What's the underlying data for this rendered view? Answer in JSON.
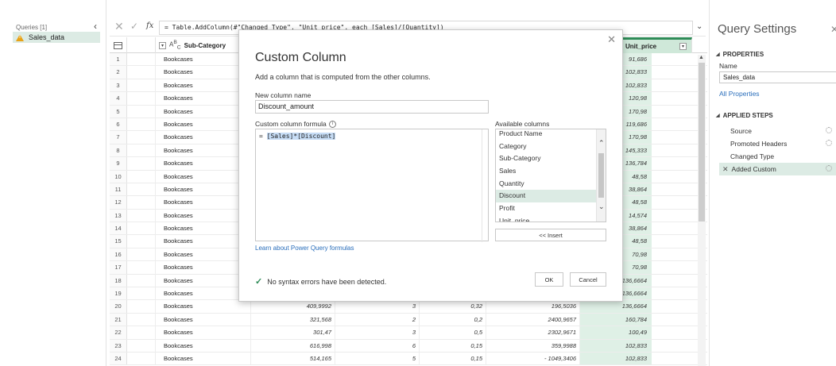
{
  "queries": {
    "title": "Queries [1]",
    "items": [
      {
        "label": "Sales_data"
      }
    ]
  },
  "formula_bar": {
    "formula": "= Table.AddColumn(#\"Changed Type\", \"Unit_price\", each [Sales]/[Quantity])"
  },
  "grid": {
    "col_sub_category": "Sub-Category",
    "col_type_icon": "ABC",
    "col_unit_price": "Unit_price",
    "rows": [
      {
        "idx": "1",
        "sub": "Bookcases",
        "sales": "",
        "qty": "",
        "disc": "",
        "profit": "",
        "unit": "91,686"
      },
      {
        "idx": "2",
        "sub": "Bookcases",
        "sales": "",
        "qty": "",
        "disc": "",
        "profit": "",
        "unit": "102,833"
      },
      {
        "idx": "3",
        "sub": "Bookcases",
        "sales": "",
        "qty": "",
        "disc": "",
        "profit": "",
        "unit": "102,833"
      },
      {
        "idx": "4",
        "sub": "Bookcases",
        "sales": "",
        "qty": "",
        "disc": "",
        "profit": "",
        "unit": "120,98"
      },
      {
        "idx": "5",
        "sub": "Bookcases",
        "sales": "",
        "qty": "",
        "disc": "",
        "profit": "",
        "unit": "170,98"
      },
      {
        "idx": "6",
        "sub": "Bookcases",
        "sales": "",
        "qty": "",
        "disc": "",
        "profit": "",
        "unit": "119,686"
      },
      {
        "idx": "7",
        "sub": "Bookcases",
        "sales": "",
        "qty": "",
        "disc": "",
        "profit": "",
        "unit": "170,98"
      },
      {
        "idx": "8",
        "sub": "Bookcases",
        "sales": "",
        "qty": "",
        "disc": "",
        "profit": "",
        "unit": "145,333"
      },
      {
        "idx": "9",
        "sub": "Bookcases",
        "sales": "",
        "qty": "",
        "disc": "",
        "profit": "",
        "unit": "136,784"
      },
      {
        "idx": "10",
        "sub": "Bookcases",
        "sales": "",
        "qty": "",
        "disc": "",
        "profit": "",
        "unit": "48,58"
      },
      {
        "idx": "11",
        "sub": "Bookcases",
        "sales": "",
        "qty": "",
        "disc": "",
        "profit": "",
        "unit": "38,864"
      },
      {
        "idx": "12",
        "sub": "Bookcases",
        "sales": "",
        "qty": "",
        "disc": "",
        "profit": "",
        "unit": "48,58"
      },
      {
        "idx": "13",
        "sub": "Bookcases",
        "sales": "",
        "qty": "",
        "disc": "",
        "profit": "",
        "unit": "14,574"
      },
      {
        "idx": "14",
        "sub": "Bookcases",
        "sales": "",
        "qty": "",
        "disc": "",
        "profit": "",
        "unit": "38,864"
      },
      {
        "idx": "15",
        "sub": "Bookcases",
        "sales": "",
        "qty": "",
        "disc": "",
        "profit": "",
        "unit": "48,58"
      },
      {
        "idx": "16",
        "sub": "Bookcases",
        "sales": "",
        "qty": "",
        "disc": "",
        "profit": "",
        "unit": "70,98"
      },
      {
        "idx": "17",
        "sub": "Bookcases",
        "sales": "",
        "qty": "",
        "disc": "",
        "profit": "",
        "unit": "70,98"
      },
      {
        "idx": "18",
        "sub": "Bookcases",
        "sales": "",
        "qty": "",
        "disc": "",
        "profit": "",
        "unit": "136,6664"
      },
      {
        "idx": "19",
        "sub": "Bookcases",
        "sales": "",
        "qty": "",
        "disc": "",
        "profit": "",
        "unit": "136,6664"
      },
      {
        "idx": "20",
        "sub": "Bookcases",
        "sales": "409,9992",
        "qty": "3",
        "disc": "0,32",
        "profit": "196,5036",
        "unit": "136,6664"
      },
      {
        "idx": "21",
        "sub": "Bookcases",
        "sales": "321,568",
        "qty": "2",
        "disc": "0,2",
        "profit": "2400,9657",
        "unit": "160,784"
      },
      {
        "idx": "22",
        "sub": "Bookcases",
        "sales": "301,47",
        "qty": "3",
        "disc": "0,5",
        "profit": "2302,9671",
        "unit": "100,49"
      },
      {
        "idx": "23",
        "sub": "Bookcases",
        "sales": "616,998",
        "qty": "6",
        "disc": "0,15",
        "profit": "359,9988",
        "unit": "102,833"
      },
      {
        "idx": "24",
        "sub": "Bookcases",
        "sales": "514,165",
        "qty": "5",
        "disc": "0,15",
        "profit": "- 1049,3406",
        "unit": "102,833"
      }
    ]
  },
  "dialog": {
    "title": "Custom Column",
    "description": "Add a column that is computed from the other columns.",
    "new_col_label": "New column name",
    "new_col_value": "Discount_amount",
    "formula_label": "Custom column formula",
    "formula_prefix": "= ",
    "formula_selected": "[Sales]*[Discount]",
    "available_label": "Available columns",
    "available_columns": [
      "Product Name",
      "Category",
      "Sub-Category",
      "Sales",
      "Quantity",
      "Discount",
      "Profit",
      "Unit_price"
    ],
    "selected_available": "Discount",
    "insert_label": "<< Insert",
    "learn_link": "Learn about Power Query formulas",
    "status": "No syntax errors have been detected.",
    "ok_label": "OK",
    "cancel_label": "Cancel"
  },
  "settings": {
    "title": "Query Settings",
    "properties_label": "PROPERTIES",
    "name_label": "Name",
    "name_value": "Sales_data",
    "all_properties": "All Properties",
    "applied_steps_label": "APPLIED STEPS",
    "steps": [
      {
        "label": "Source",
        "gear": true
      },
      {
        "label": "Promoted Headers",
        "gear": true
      },
      {
        "label": "Changed Type",
        "gear": false
      },
      {
        "label": "Added Custom",
        "gear": true
      }
    ],
    "active_step": "Added Custom"
  },
  "colors": {
    "accent_green": "#2e8b57",
    "selection_green": "#dcebe4",
    "link_blue": "#2a6ebb",
    "warning": "#e8a317"
  }
}
